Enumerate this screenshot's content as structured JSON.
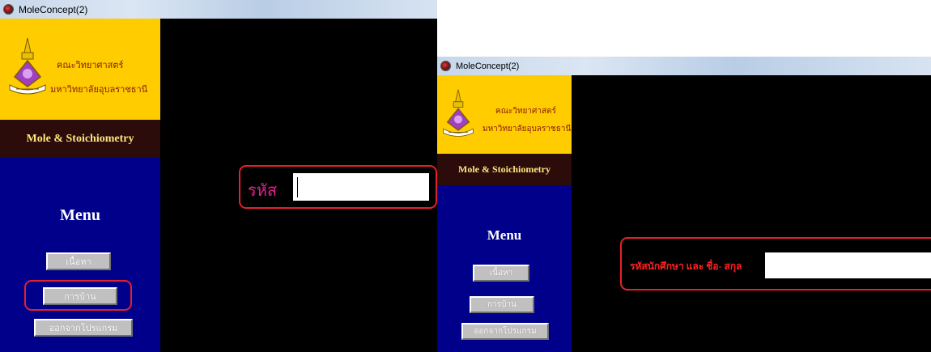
{
  "window_left": {
    "title": "MoleConcept(2)",
    "faculty_line1": "คณะวิทยาศาสตร์",
    "faculty_line2": "มหาวิทยาลัยอุบลราชธานี",
    "course_title": "Mole & Stoichiometry",
    "menu_title": "Menu",
    "menu_items": [
      "เนื้อหา",
      "การบ้าน",
      "ออกจากโปรแกรม"
    ],
    "field_label": "รหัส",
    "field_value": ""
  },
  "window_right": {
    "title": "MoleConcept(2)",
    "faculty_line1": "คณะวิทยาศาสตร์",
    "faculty_line2": "มหาวิทยาลัยอุบลราชธานี",
    "course_title": "Mole & Stoichiometry",
    "menu_title": "Menu",
    "menu_items": [
      "เนื้อหา",
      "การบ้าน",
      "ออกจากโปรแกรม"
    ],
    "field_label": "รหัสนักศึกษา และ ชื่อ- สกุล",
    "field_value": ""
  },
  "colors": {
    "logo_bg": "#ffcc00",
    "course_bg": "#2c0b0b",
    "menu_bg": "#00008b",
    "highlight": "#e4202c",
    "left_label": "#e0208c",
    "right_label": "#ff2020"
  },
  "icons": [
    "app-icon",
    "university-emblem-icon"
  ]
}
